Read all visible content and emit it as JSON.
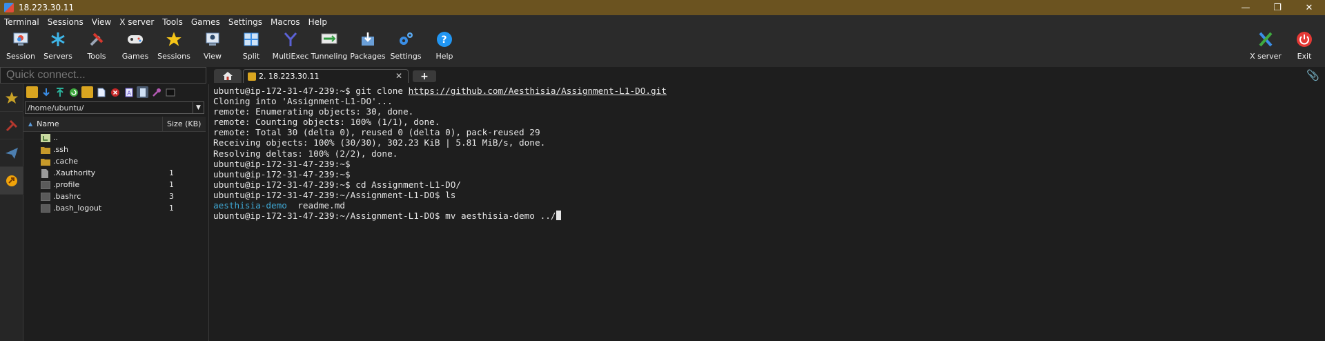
{
  "window": {
    "title": "18.223.30.11"
  },
  "menu": [
    "Terminal",
    "Sessions",
    "View",
    "X server",
    "Tools",
    "Games",
    "Settings",
    "Macros",
    "Help"
  ],
  "toolbar": {
    "left": [
      {
        "label": "Session",
        "icon": "session-icon"
      },
      {
        "label": "Servers",
        "icon": "servers-icon"
      },
      {
        "label": "Tools",
        "icon": "tools-icon"
      },
      {
        "label": "Games",
        "icon": "games-icon"
      },
      {
        "label": "Sessions",
        "icon": "star-icon"
      },
      {
        "label": "View",
        "icon": "view-icon"
      },
      {
        "label": "Split",
        "icon": "split-icon"
      },
      {
        "label": "MultiExec",
        "icon": "multiexec-icon"
      },
      {
        "label": "Tunneling",
        "icon": "tunneling-icon"
      },
      {
        "label": "Packages",
        "icon": "packages-icon"
      },
      {
        "label": "Settings",
        "icon": "settings-icon"
      },
      {
        "label": "Help",
        "icon": "help-icon"
      }
    ],
    "right": [
      {
        "label": "X server",
        "icon": "x-server-icon"
      },
      {
        "label": "Exit",
        "icon": "power-icon"
      }
    ]
  },
  "quick_connect": {
    "placeholder": "Quick connect..."
  },
  "sftp": {
    "path": "/home/ubuntu/",
    "columns": {
      "name": "Name",
      "size": "Size (KB)"
    },
    "files": [
      {
        "name": "..",
        "size": "",
        "type": "parent"
      },
      {
        "name": ".ssh",
        "size": "",
        "type": "folder"
      },
      {
        "name": ".cache",
        "size": "",
        "type": "folder"
      },
      {
        "name": ".Xauthority",
        "size": "1",
        "type": "file"
      },
      {
        "name": ".profile",
        "size": "1",
        "type": "file-dark"
      },
      {
        "name": ".bashrc",
        "size": "3",
        "type": "file-dark"
      },
      {
        "name": ".bash_logout",
        "size": "1",
        "type": "file-dark"
      }
    ]
  },
  "tabs": {
    "session_label": "2. 18.223.30.11"
  },
  "terminal": {
    "lines": [
      {
        "segments": [
          {
            "text": "ubuntu@ip-172-31-47-239:~$ git clone "
          },
          {
            "text": "https://github.com/Aesthisia/Assignment-L1-DO.git",
            "style": "link"
          }
        ]
      },
      {
        "segments": [
          {
            "text": "Cloning into 'Assignment-L1-DO'..."
          }
        ]
      },
      {
        "segments": [
          {
            "text": "remote: Enumerating objects: 30, done."
          }
        ]
      },
      {
        "segments": [
          {
            "text": "remote: Counting objects: 100% (1/1), done."
          }
        ]
      },
      {
        "segments": [
          {
            "text": "remote: Total 30 (delta 0), reused 0 (delta 0), pack-reused 29"
          }
        ]
      },
      {
        "segments": [
          {
            "text": "Receiving objects: 100% (30/30), 302.23 KiB | 5.81 MiB/s, done."
          }
        ]
      },
      {
        "segments": [
          {
            "text": "Resolving deltas: 100% (2/2), done."
          }
        ]
      },
      {
        "segments": [
          {
            "text": "ubuntu@ip-172-31-47-239:~$"
          }
        ]
      },
      {
        "segments": [
          {
            "text": "ubuntu@ip-172-31-47-239:~$"
          }
        ]
      },
      {
        "segments": [
          {
            "text": "ubuntu@ip-172-31-47-239:~$ cd Assignment-L1-DO/"
          }
        ]
      },
      {
        "segments": [
          {
            "text": "ubuntu@ip-172-31-47-239:~/Assignment-L1-DO$ ls"
          }
        ]
      },
      {
        "segments": [
          {
            "text": "aesthisia-demo",
            "style": "dir"
          },
          {
            "text": "  readme.md"
          }
        ]
      },
      {
        "segments": [
          {
            "text": "ubuntu@ip-172-31-47-239:~/Assignment-L1-DO$ mv aesthisia-demo ../"
          }
        ],
        "cursor": true
      }
    ]
  },
  "colors": {
    "titlebar": "#6b5320",
    "link_dir": "#3fa9d6",
    "accent": "#3a8ee6"
  }
}
